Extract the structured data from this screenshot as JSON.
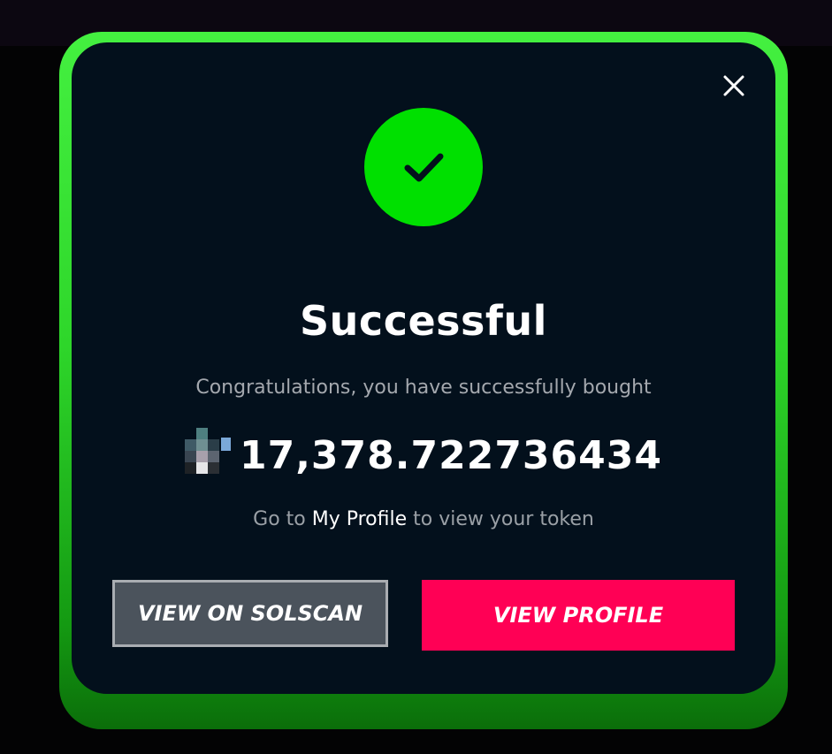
{
  "modal": {
    "close_icon": "close-icon",
    "status_icon": "checkmark-icon",
    "title": "Successful",
    "message": "Congratulations, you have successfully bought",
    "token_icon": "token-icon",
    "amount": "17,378.722736434",
    "hint": {
      "prefix": "Go to ",
      "link": "My Profile",
      "suffix": " to view your token"
    },
    "buttons": {
      "solscan": "VIEW ON SOLSCAN",
      "profile": "VIEW PROFILE"
    }
  },
  "colors": {
    "frame_accent": "#44f040",
    "success": "#00e000",
    "card_background": "#03101c",
    "primary_button": "#ff0055",
    "secondary_button": "#4b535c"
  }
}
